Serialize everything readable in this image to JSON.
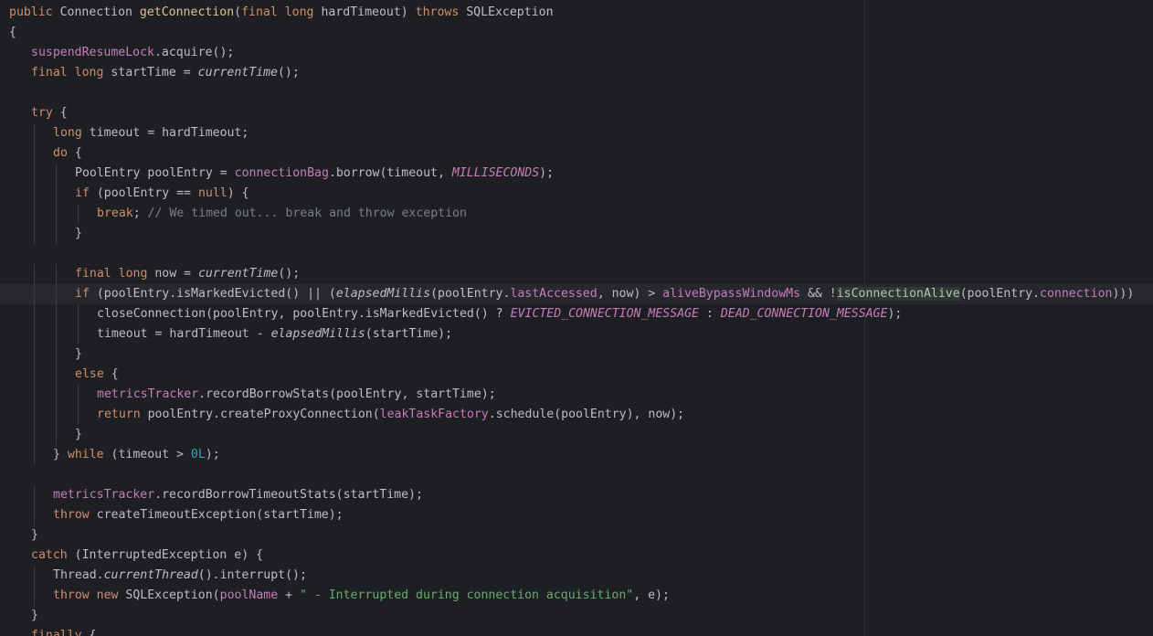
{
  "editor": {
    "colors": {
      "background": "#1e1f22",
      "current_line": "#26282e",
      "keyword": "#cf8e6d",
      "method_declaration": "#56a8f5",
      "field": "#c77dbb",
      "string": "#6aab73",
      "number": "#2aacb8",
      "comment": "#7a7e85",
      "default_text": "#bcbec4"
    },
    "lines": [
      [
        [
          "kw",
          "public "
        ],
        [
          "p",
          "Connection "
        ],
        [
          "dec",
          "getConnection"
        ],
        [
          "p",
          "("
        ],
        [
          "kw",
          "final long "
        ],
        [
          "p",
          "hardTimeout) "
        ],
        [
          "kw",
          "throws "
        ],
        [
          "p",
          "SQLException"
        ]
      ],
      [
        [
          "p",
          "{"
        ]
      ],
      [
        [
          "fld",
          "suspendResumeLock"
        ],
        [
          "p",
          ".acquire();"
        ]
      ],
      [
        [
          "kw",
          "final long "
        ],
        [
          "p",
          "startTime = "
        ],
        [
          "sm",
          "currentTime"
        ],
        [
          "p",
          "();"
        ]
      ],
      [],
      [
        [
          "kw",
          "try "
        ],
        [
          "p",
          "{"
        ]
      ],
      [
        [
          "kw",
          "long "
        ],
        [
          "p",
          "timeout = hardTimeout;"
        ]
      ],
      [
        [
          "kw",
          "do "
        ],
        [
          "p",
          "{"
        ]
      ],
      [
        [
          "p",
          "PoolEntry poolEntry = "
        ],
        [
          "fld",
          "connectionBag"
        ],
        [
          "p",
          ".borrow(timeout, "
        ],
        [
          "sf",
          "MILLISECONDS"
        ],
        [
          "p",
          ");"
        ]
      ],
      [
        [
          "kw",
          "if "
        ],
        [
          "p",
          "(poolEntry == "
        ],
        [
          "kw",
          "null"
        ],
        [
          "p",
          ") {"
        ]
      ],
      [
        [
          "kw",
          "break"
        ],
        [
          "p",
          "; "
        ],
        [
          "cmt",
          "// We timed out... break and throw exception"
        ]
      ],
      [
        [
          "p",
          "}"
        ]
      ],
      [],
      [
        [
          "kw",
          "final long "
        ],
        [
          "p",
          "now = "
        ],
        [
          "sm",
          "currentTime"
        ],
        [
          "p",
          "();"
        ]
      ],
      [
        [
          "kw",
          "if "
        ],
        [
          "p",
          "(poolEntry.isMarkedEvicted() || ("
        ],
        [
          "sm",
          "elapsedMillis"
        ],
        [
          "p",
          "(poolEntry."
        ],
        [
          "fld",
          "lastAccessed"
        ],
        [
          "p",
          ", now) > "
        ],
        [
          "fld",
          "aliveBypassWindowMs"
        ],
        [
          "p",
          " && !"
        ],
        [
          "hl",
          "isConnectionAlive"
        ],
        [
          "p",
          "(poolEntry."
        ],
        [
          "fld",
          "connection"
        ],
        [
          "p",
          ")))"
        ]
      ],
      [
        [
          "p",
          "closeConnection(poolEntry, poolEntry.isMarkedEvicted() ? "
        ],
        [
          "sf",
          "EVICTED_CONNECTION_MESSAGE"
        ],
        [
          "p",
          " : "
        ],
        [
          "sf",
          "DEAD_CONNECTION_MESSAGE"
        ],
        [
          "p",
          ");"
        ]
      ],
      [
        [
          "p",
          "timeout = hardTimeout - "
        ],
        [
          "sm",
          "elapsedMillis"
        ],
        [
          "p",
          "(startTime);"
        ]
      ],
      [
        [
          "p",
          "}"
        ]
      ],
      [
        [
          "kw",
          "else "
        ],
        [
          "p",
          "{"
        ]
      ],
      [
        [
          "fld",
          "metricsTracker"
        ],
        [
          "p",
          ".recordBorrowStats(poolEntry, startTime);"
        ]
      ],
      [
        [
          "kw",
          "return "
        ],
        [
          "p",
          "poolEntry.createProxyConnection("
        ],
        [
          "fld",
          "leakTaskFactory"
        ],
        [
          "p",
          ".schedule(poolEntry), now);"
        ]
      ],
      [
        [
          "p",
          "}"
        ]
      ],
      [
        [
          "p",
          "} "
        ],
        [
          "kw",
          "while "
        ],
        [
          "p",
          "(timeout > "
        ],
        [
          "num",
          "0L"
        ],
        [
          "p",
          ");"
        ]
      ],
      [],
      [
        [
          "fld",
          "metricsTracker"
        ],
        [
          "p",
          ".recordBorrowTimeoutStats(startTime);"
        ]
      ],
      [
        [
          "kw",
          "throw "
        ],
        [
          "p",
          "createTimeoutException(startTime);"
        ]
      ],
      [
        [
          "p",
          "}"
        ]
      ],
      [
        [
          "kw",
          "catch "
        ],
        [
          "p",
          "(InterruptedException e) {"
        ]
      ],
      [
        [
          "p",
          "Thread."
        ],
        [
          "sm",
          "currentThread"
        ],
        [
          "p",
          "().interrupt();"
        ]
      ],
      [
        [
          "kw",
          "throw new "
        ],
        [
          "p",
          "SQLException("
        ],
        [
          "fld",
          "poolName"
        ],
        [
          "p",
          " + "
        ],
        [
          "str",
          "\" - Interrupted during connection acquisition\""
        ],
        [
          "p",
          ", e);"
        ]
      ],
      [
        [
          "p",
          "}"
        ]
      ],
      [
        [
          "kw",
          "finally "
        ],
        [
          "p",
          "{"
        ]
      ]
    ]
  }
}
